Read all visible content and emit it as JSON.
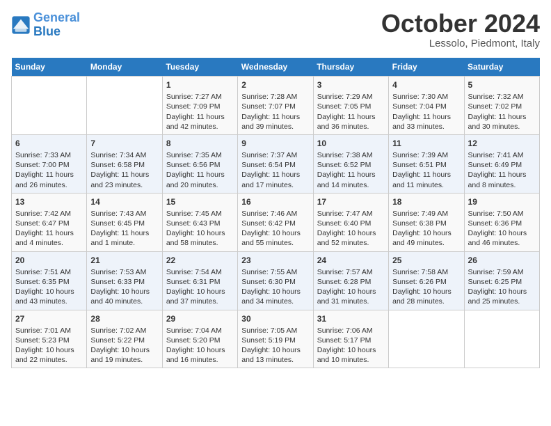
{
  "logo": {
    "line1": "General",
    "line2": "Blue"
  },
  "title": "October 2024",
  "location": "Lessolo, Piedmont, Italy",
  "weekdays": [
    "Sunday",
    "Monday",
    "Tuesday",
    "Wednesday",
    "Thursday",
    "Friday",
    "Saturday"
  ],
  "weeks": [
    [
      {
        "day": "",
        "info": ""
      },
      {
        "day": "",
        "info": ""
      },
      {
        "day": "1",
        "info": "Sunrise: 7:27 AM\nSunset: 7:09 PM\nDaylight: 11 hours and 42 minutes."
      },
      {
        "day": "2",
        "info": "Sunrise: 7:28 AM\nSunset: 7:07 PM\nDaylight: 11 hours and 39 minutes."
      },
      {
        "day": "3",
        "info": "Sunrise: 7:29 AM\nSunset: 7:05 PM\nDaylight: 11 hours and 36 minutes."
      },
      {
        "day": "4",
        "info": "Sunrise: 7:30 AM\nSunset: 7:04 PM\nDaylight: 11 hours and 33 minutes."
      },
      {
        "day": "5",
        "info": "Sunrise: 7:32 AM\nSunset: 7:02 PM\nDaylight: 11 hours and 30 minutes."
      }
    ],
    [
      {
        "day": "6",
        "info": "Sunrise: 7:33 AM\nSunset: 7:00 PM\nDaylight: 11 hours and 26 minutes."
      },
      {
        "day": "7",
        "info": "Sunrise: 7:34 AM\nSunset: 6:58 PM\nDaylight: 11 hours and 23 minutes."
      },
      {
        "day": "8",
        "info": "Sunrise: 7:35 AM\nSunset: 6:56 PM\nDaylight: 11 hours and 20 minutes."
      },
      {
        "day": "9",
        "info": "Sunrise: 7:37 AM\nSunset: 6:54 PM\nDaylight: 11 hours and 17 minutes."
      },
      {
        "day": "10",
        "info": "Sunrise: 7:38 AM\nSunset: 6:52 PM\nDaylight: 11 hours and 14 minutes."
      },
      {
        "day": "11",
        "info": "Sunrise: 7:39 AM\nSunset: 6:51 PM\nDaylight: 11 hours and 11 minutes."
      },
      {
        "day": "12",
        "info": "Sunrise: 7:41 AM\nSunset: 6:49 PM\nDaylight: 11 hours and 8 minutes."
      }
    ],
    [
      {
        "day": "13",
        "info": "Sunrise: 7:42 AM\nSunset: 6:47 PM\nDaylight: 11 hours and 4 minutes."
      },
      {
        "day": "14",
        "info": "Sunrise: 7:43 AM\nSunset: 6:45 PM\nDaylight: 11 hours and 1 minute."
      },
      {
        "day": "15",
        "info": "Sunrise: 7:45 AM\nSunset: 6:43 PM\nDaylight: 10 hours and 58 minutes."
      },
      {
        "day": "16",
        "info": "Sunrise: 7:46 AM\nSunset: 6:42 PM\nDaylight: 10 hours and 55 minutes."
      },
      {
        "day": "17",
        "info": "Sunrise: 7:47 AM\nSunset: 6:40 PM\nDaylight: 10 hours and 52 minutes."
      },
      {
        "day": "18",
        "info": "Sunrise: 7:49 AM\nSunset: 6:38 PM\nDaylight: 10 hours and 49 minutes."
      },
      {
        "day": "19",
        "info": "Sunrise: 7:50 AM\nSunset: 6:36 PM\nDaylight: 10 hours and 46 minutes."
      }
    ],
    [
      {
        "day": "20",
        "info": "Sunrise: 7:51 AM\nSunset: 6:35 PM\nDaylight: 10 hours and 43 minutes."
      },
      {
        "day": "21",
        "info": "Sunrise: 7:53 AM\nSunset: 6:33 PM\nDaylight: 10 hours and 40 minutes."
      },
      {
        "day": "22",
        "info": "Sunrise: 7:54 AM\nSunset: 6:31 PM\nDaylight: 10 hours and 37 minutes."
      },
      {
        "day": "23",
        "info": "Sunrise: 7:55 AM\nSunset: 6:30 PM\nDaylight: 10 hours and 34 minutes."
      },
      {
        "day": "24",
        "info": "Sunrise: 7:57 AM\nSunset: 6:28 PM\nDaylight: 10 hours and 31 minutes."
      },
      {
        "day": "25",
        "info": "Sunrise: 7:58 AM\nSunset: 6:26 PM\nDaylight: 10 hours and 28 minutes."
      },
      {
        "day": "26",
        "info": "Sunrise: 7:59 AM\nSunset: 6:25 PM\nDaylight: 10 hours and 25 minutes."
      }
    ],
    [
      {
        "day": "27",
        "info": "Sunrise: 7:01 AM\nSunset: 5:23 PM\nDaylight: 10 hours and 22 minutes."
      },
      {
        "day": "28",
        "info": "Sunrise: 7:02 AM\nSunset: 5:22 PM\nDaylight: 10 hours and 19 minutes."
      },
      {
        "day": "29",
        "info": "Sunrise: 7:04 AM\nSunset: 5:20 PM\nDaylight: 10 hours and 16 minutes."
      },
      {
        "day": "30",
        "info": "Sunrise: 7:05 AM\nSunset: 5:19 PM\nDaylight: 10 hours and 13 minutes."
      },
      {
        "day": "31",
        "info": "Sunrise: 7:06 AM\nSunset: 5:17 PM\nDaylight: 10 hours and 10 minutes."
      },
      {
        "day": "",
        "info": ""
      },
      {
        "day": "",
        "info": ""
      }
    ]
  ]
}
